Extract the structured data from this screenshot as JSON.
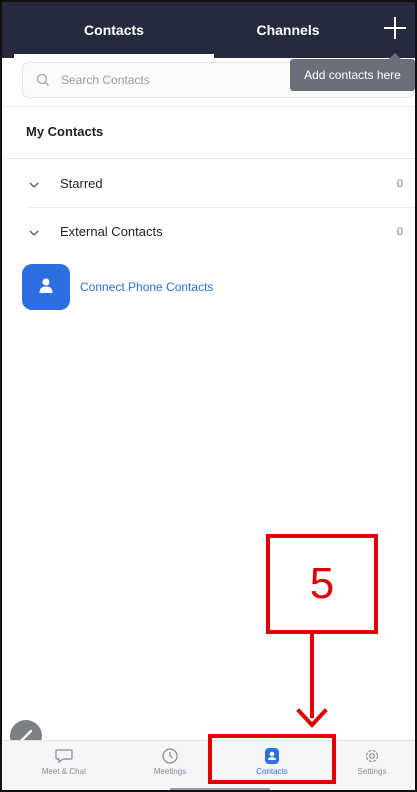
{
  "header": {
    "tabs": [
      {
        "label": "Contacts",
        "active": true
      },
      {
        "label": "Channels",
        "active": false
      }
    ],
    "add_icon": "plus-icon"
  },
  "tooltip": {
    "text": "Add contacts here"
  },
  "search": {
    "placeholder": "Search Contacts"
  },
  "section": {
    "title": "My Contacts"
  },
  "groups": [
    {
      "label": "Starred",
      "count": "0"
    },
    {
      "label": "External Contacts",
      "count": "0"
    }
  ],
  "connect": {
    "label": "Connect Phone Contacts",
    "icon": "person-icon"
  },
  "nav": {
    "items": [
      {
        "label": "Meet & Chat",
        "icon": "chat-bubble-icon"
      },
      {
        "label": "Meetings",
        "icon": "clock-icon"
      },
      {
        "label": "Contacts",
        "icon": "contacts-icon",
        "active": true
      },
      {
        "label": "Settings",
        "icon": "gear-icon"
      }
    ]
  },
  "annotation": {
    "step": "5"
  },
  "colors": {
    "header_bg": "#262a3f",
    "accent": "#2d6fe0",
    "annotation": "#e00000"
  }
}
